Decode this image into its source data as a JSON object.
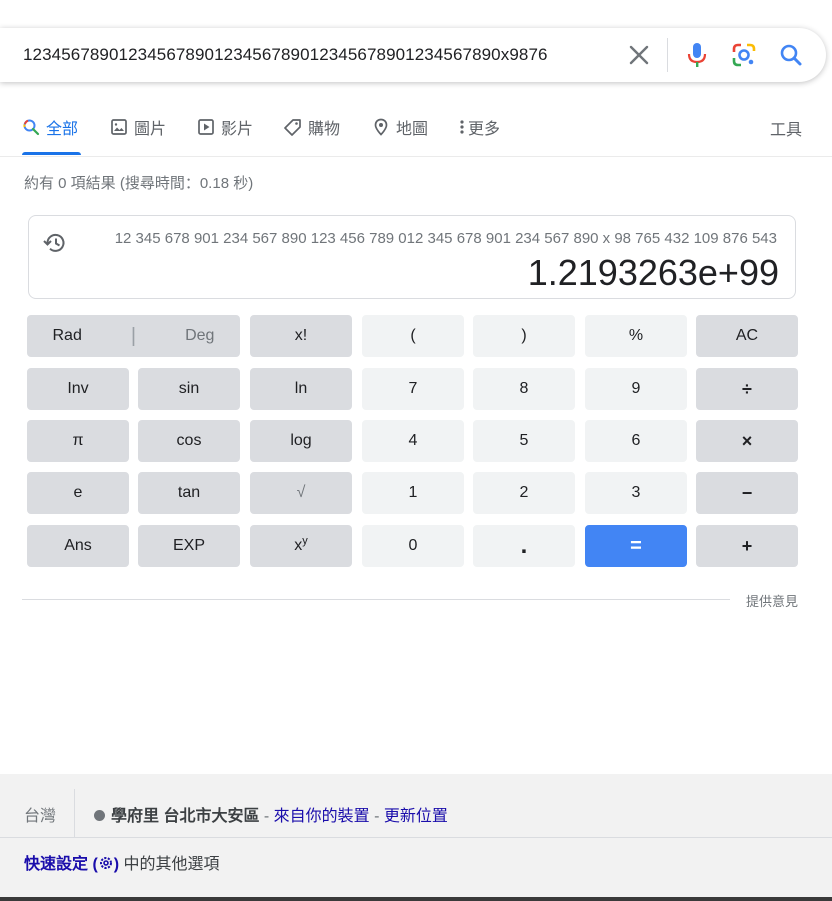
{
  "search": {
    "query": "1234567890123456789012345678901234567890123456789 0x9876",
    "query_display": "12345678901234567890123456789012345678901234567890x9876"
  },
  "tabs": [
    {
      "label": "全部",
      "icon": "search-icon",
      "active": true
    },
    {
      "label": "圖片",
      "icon": "image-icon"
    },
    {
      "label": "影片",
      "icon": "video-icon"
    },
    {
      "label": "購物",
      "icon": "tag-icon"
    },
    {
      "label": "地圖",
      "icon": "map-pin-icon"
    },
    {
      "label": "更多",
      "icon": "more-vert-icon"
    }
  ],
  "tools_label": "工具",
  "result_stats": "約有 0 項結果 (搜尋時間：0.18 秒)",
  "calculator": {
    "expression": "12 345 678 901 234 567 890 123 456 789 012 345 678 901 234 567 890 x 98 765 432 109 876 543",
    "result": "1.2193263e+99",
    "keys": {
      "rad": "Rad",
      "deg": "Deg",
      "fact": "x!",
      "lparen": "(",
      "rparen": ")",
      "percent": "%",
      "ac": "AC",
      "inv": "Inv",
      "sin": "sin",
      "ln": "ln",
      "k7": "7",
      "k8": "8",
      "k9": "9",
      "div": "÷",
      "pi": "π",
      "cos": "cos",
      "log": "log",
      "k4": "4",
      "k5": "5",
      "k6": "6",
      "mul": "×",
      "e": "e",
      "tan": "tan",
      "sqrt": "√",
      "k1": "1",
      "k2": "2",
      "k3": "3",
      "minus": "−",
      "ans": "Ans",
      "exp": "EXP",
      "pow_base": "x",
      "pow_sup": "y",
      "k0": "0",
      "dot": ".",
      "eq": "=",
      "plus": "+"
    }
  },
  "feedback": "提供意見",
  "footer": {
    "country": "台灣",
    "place": "學府里 台北市大安區",
    "sep1": " - ",
    "from_device": "來自你的裝置",
    "sep2": " - ",
    "update_location": "更新位置",
    "quick_settings": "快速設定 (",
    "quick_settings_end": ")",
    "other_options": " 中的其他選項"
  },
  "colors": {
    "accent": "#1a73e8",
    "equals": "#4285f4",
    "link": "#1a0dab"
  }
}
